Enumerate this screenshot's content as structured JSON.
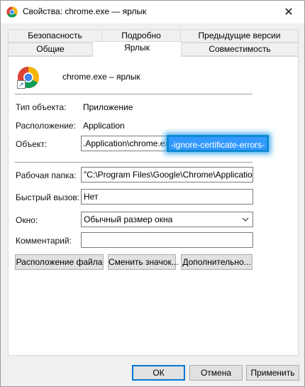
{
  "window": {
    "title": "Свойства: chrome.exe — ярлык",
    "close_glyph": "✕"
  },
  "tabs": {
    "row1": [
      "Безопасность",
      "Подробно",
      "Предыдущие версии"
    ],
    "row2": [
      "Общие",
      "Ярлык",
      "Совместимость"
    ],
    "active": "Ярлык"
  },
  "shortcut": {
    "name": "chrome.exe – ярлык",
    "icon": "chrome-icon",
    "type_label": "Тип объекта:",
    "type_value": "Приложение",
    "location_label": "Расположение:",
    "location_value": "Application",
    "target_label": "Объект:",
    "target_value_visible": ".Application\\chrome.exe",
    "target_value_selected": "-ignore-certificate-errors-",
    "workdir_label": "Рабочая папка:",
    "workdir_value": "\"C:\\Program Files\\Google\\Chrome\\Application\"",
    "hotkey_label": "Быстрый вызов:",
    "hotkey_value": "Нет",
    "window_label": "Окно:",
    "window_value": "Обычный размер окна",
    "comment_label": "Комментарий:",
    "comment_value": ""
  },
  "actions": {
    "open_location": "Расположение файла",
    "change_icon": "Сменить значок...",
    "advanced": "Дополнительно..."
  },
  "footer": {
    "ok": "ОК",
    "cancel": "Отмена",
    "apply": "Применить"
  },
  "colors": {
    "selection": "#3399ff",
    "highlight_ring": "#0f8ad2",
    "default_button_border": "#0078d7"
  }
}
